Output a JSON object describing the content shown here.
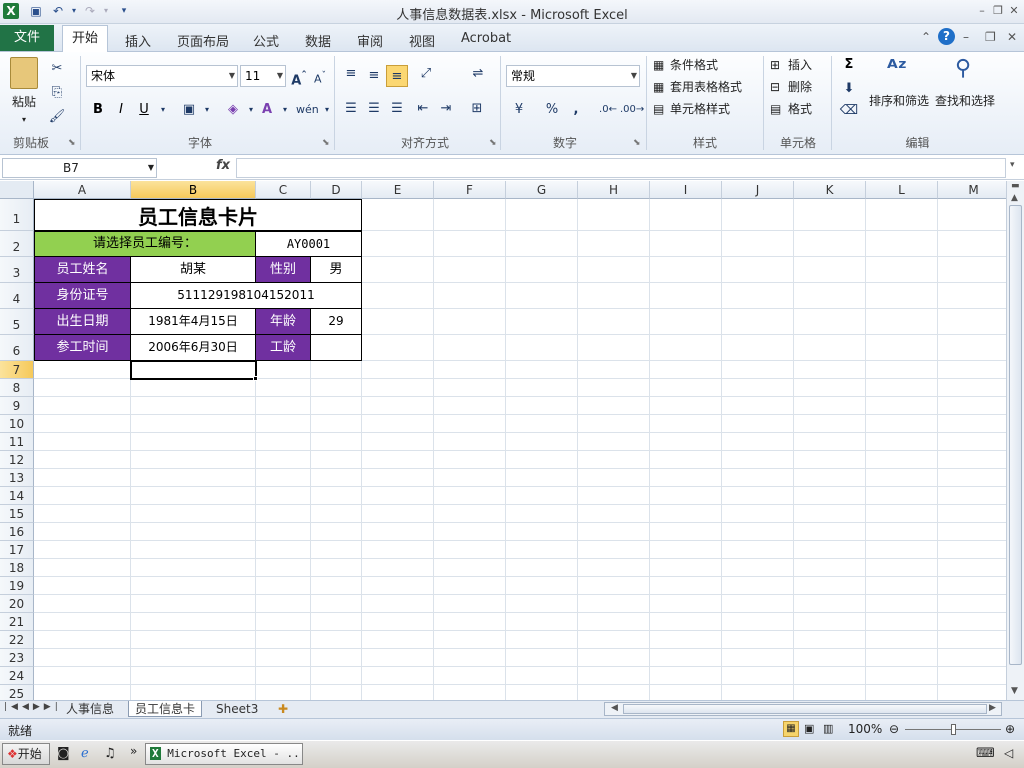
{
  "window": {
    "title": "人事信息数据表.xlsx - Microsoft Excel"
  },
  "ribbon": {
    "tabs": [
      "文件",
      "开始",
      "插入",
      "页面布局",
      "公式",
      "数据",
      "审阅",
      "视图",
      "Acrobat"
    ],
    "clipboard": {
      "paste": "粘贴",
      "group": "剪贴板"
    },
    "font": {
      "name": "宋体",
      "size": "11",
      "group": "字体",
      "bold": "B",
      "italic": "I",
      "underline": "U"
    },
    "alignment": {
      "group": "对齐方式"
    },
    "number": {
      "format": "常规",
      "group": "数字",
      "percent": "%",
      "comma": ","
    },
    "styles": {
      "conditional": "条件格式",
      "table": "套用表格格式",
      "cell": "单元格样式",
      "group": "样式"
    },
    "cells": {
      "insert": "插入",
      "delete": "删除",
      "format": "格式",
      "group": "单元格"
    },
    "editing": {
      "sort": "排序和筛选",
      "find": "查找和选择",
      "group": "编辑",
      "sigma": "Σ"
    }
  },
  "formula_bar": {
    "name_box": "B7",
    "fx": "fx",
    "content": ""
  },
  "columns": [
    "A",
    "B",
    "C",
    "D",
    "E",
    "F",
    "G",
    "H",
    "I",
    "J",
    "K",
    "L",
    "M"
  ],
  "rows": [
    "1",
    "2",
    "3",
    "4",
    "5",
    "6",
    "7",
    "8",
    "9",
    "10",
    "11",
    "12",
    "13",
    "14",
    "15",
    "16",
    "17",
    "18",
    "19",
    "20",
    "21",
    "22",
    "23",
    "24",
    "25"
  ],
  "card": {
    "title": "员工信息卡片",
    "select_label": "请选择员工编号：",
    "employee_id": "AY0001",
    "name_label": "员工姓名",
    "name_value": "胡某",
    "gender_label": "性别",
    "gender_value": "男",
    "id_label": "身份证号",
    "id_value": "511129198104152011",
    "birth_label": "出生日期",
    "birth_value": "1981年4月15日",
    "age_label": "年龄",
    "age_value": "29",
    "join_label": "参工时间",
    "join_value": "2006年6月30日",
    "tenure_label": "工龄",
    "tenure_value": ""
  },
  "sheets": [
    "人事信息",
    "员工信息卡",
    "Sheet3"
  ],
  "status": {
    "ready": "就绪",
    "zoom": "100%"
  },
  "taskbar": {
    "start": "开始",
    "window": "Microsoft Excel - ..."
  }
}
